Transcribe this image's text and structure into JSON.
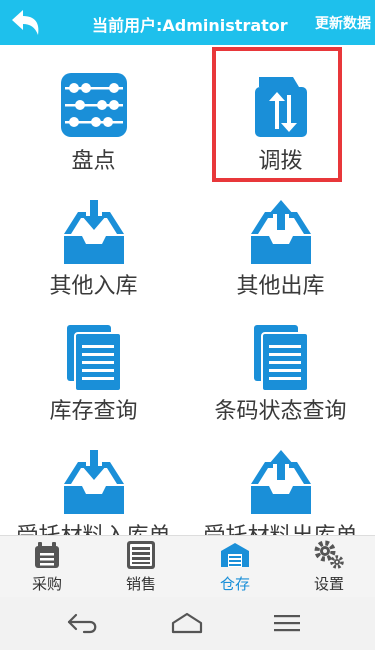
{
  "header": {
    "title": "当前用户:Administrator",
    "update_label": "更新数据"
  },
  "grid": {
    "items": [
      {
        "label": "盘点",
        "icon": "abacus-icon"
      },
      {
        "label": "调拨",
        "icon": "transfer-icon"
      },
      {
        "label": "其他入库",
        "icon": "inbox-in-icon"
      },
      {
        "label": "其他出库",
        "icon": "inbox-out-icon"
      },
      {
        "label": "库存查询",
        "icon": "document-icon"
      },
      {
        "label": "条码状态查询",
        "icon": "document-icon"
      },
      {
        "label": "受托材料入库单",
        "icon": "inbox-in-icon"
      },
      {
        "label": "受托材料出库单",
        "icon": "inbox-out-icon"
      }
    ],
    "highlighted_item": "调拨"
  },
  "bottom_nav": {
    "items": [
      {
        "label": "采购",
        "icon": "purchase-icon"
      },
      {
        "label": "销售",
        "icon": "sales-icon"
      },
      {
        "label": "仓存",
        "icon": "warehouse-icon"
      },
      {
        "label": "设置",
        "icon": "settings-gear-icon"
      }
    ],
    "active": "仓存"
  },
  "system_bar": {
    "buttons": [
      "back-nav-icon",
      "home-nav-icon",
      "menu-nav-icon"
    ]
  },
  "colors": {
    "header_bg": "#1ec0ec",
    "icon_blue": "#1a8fd8",
    "highlight_border": "#e8373a"
  }
}
